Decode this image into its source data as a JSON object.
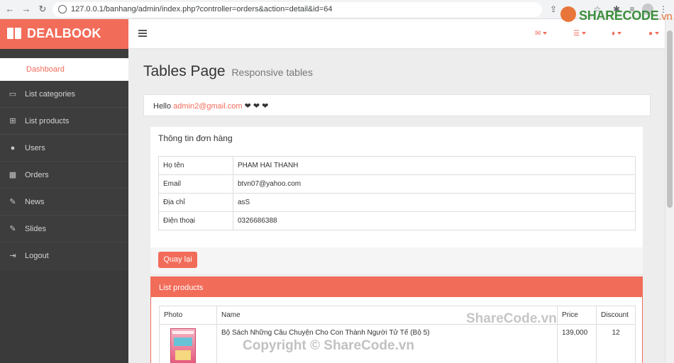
{
  "browser": {
    "url": "127.0.0.1/banhang/admin/index.php?controller=orders&action=detail&id=64"
  },
  "brand": {
    "name": "DEALBOOK"
  },
  "sidebar": {
    "items": [
      {
        "label": "Dashboard",
        "icon": "dashboard",
        "active": true
      },
      {
        "label": "List categories",
        "icon": "desktop-icon"
      },
      {
        "label": "List products",
        "icon": "sitemap-icon"
      },
      {
        "label": "Users",
        "icon": "user-icon"
      },
      {
        "label": "Orders",
        "icon": "table-icon"
      },
      {
        "label": "News",
        "icon": "edit-icon"
      },
      {
        "label": "Slides",
        "icon": "edit-icon"
      },
      {
        "label": "Logout",
        "icon": "sign-out-icon"
      }
    ]
  },
  "page": {
    "title": "Tables Page",
    "subtitle": "Responsive tables"
  },
  "hello": {
    "prefix": "Hello",
    "email": "admin2@gmail.com",
    "hearts": "❤ ❤ ❤"
  },
  "order_info": {
    "title": "Thông tin đơn hàng",
    "rows": [
      {
        "label": "Họ tên",
        "value": "PHAM HAI THANH"
      },
      {
        "label": "Email",
        "value": "btvn07@yahoo.com"
      },
      {
        "label": "Địa chỉ",
        "value": "asS"
      },
      {
        "label": "Điện thoại",
        "value": "0326686388"
      }
    ],
    "back_label": "Quay lại"
  },
  "products": {
    "title": "List products",
    "columns": [
      "Photo",
      "Name",
      "Price",
      "Discount"
    ],
    "rows": [
      {
        "name": "Bộ Sách Những Câu Chuyện Cho Con Thành Người Tử Tế (Bộ 5)",
        "price": "139,000",
        "discount": "12"
      }
    ]
  },
  "watermarks": {
    "logo_main": "SHARECODE",
    "logo_tld": ".vn",
    "mid": "ShareCode.vn",
    "big": "Copyright © ShareCode.vn"
  },
  "colors": {
    "accent": "#f26c5a",
    "sidebar": "#3d3d3d",
    "content_bg": "#ededed"
  }
}
